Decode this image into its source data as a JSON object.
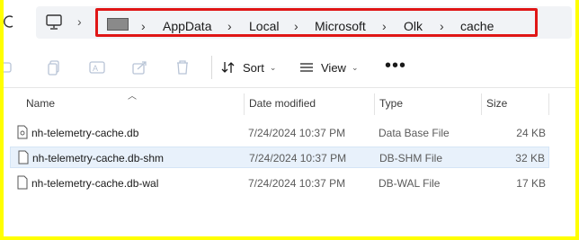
{
  "address": {
    "breadcrumbs": [
      "AppData",
      "Local",
      "Microsoft",
      "Olk",
      "cache"
    ]
  },
  "toolbar": {
    "sort_label": "Sort",
    "view_label": "View",
    "more_label": "•••"
  },
  "columns": {
    "name": "Name",
    "date": "Date modified",
    "type": "Type",
    "size": "Size"
  },
  "files": [
    {
      "name": "nh-telemetry-cache.db",
      "date": "7/24/2024 10:37 PM",
      "type": "Data Base File",
      "size": "24 KB"
    },
    {
      "name": "nh-telemetry-cache.db-shm",
      "date": "7/24/2024 10:37 PM",
      "type": "DB-SHM File",
      "size": "32 KB"
    },
    {
      "name": "nh-telemetry-cache.db-wal",
      "date": "7/24/2024 10:37 PM",
      "type": "DB-WAL File",
      "size": "17 KB"
    }
  ],
  "colors": {
    "highlight_border": "#e01616",
    "frame": "#ffff00",
    "selected_row": "#e8f1fb"
  }
}
